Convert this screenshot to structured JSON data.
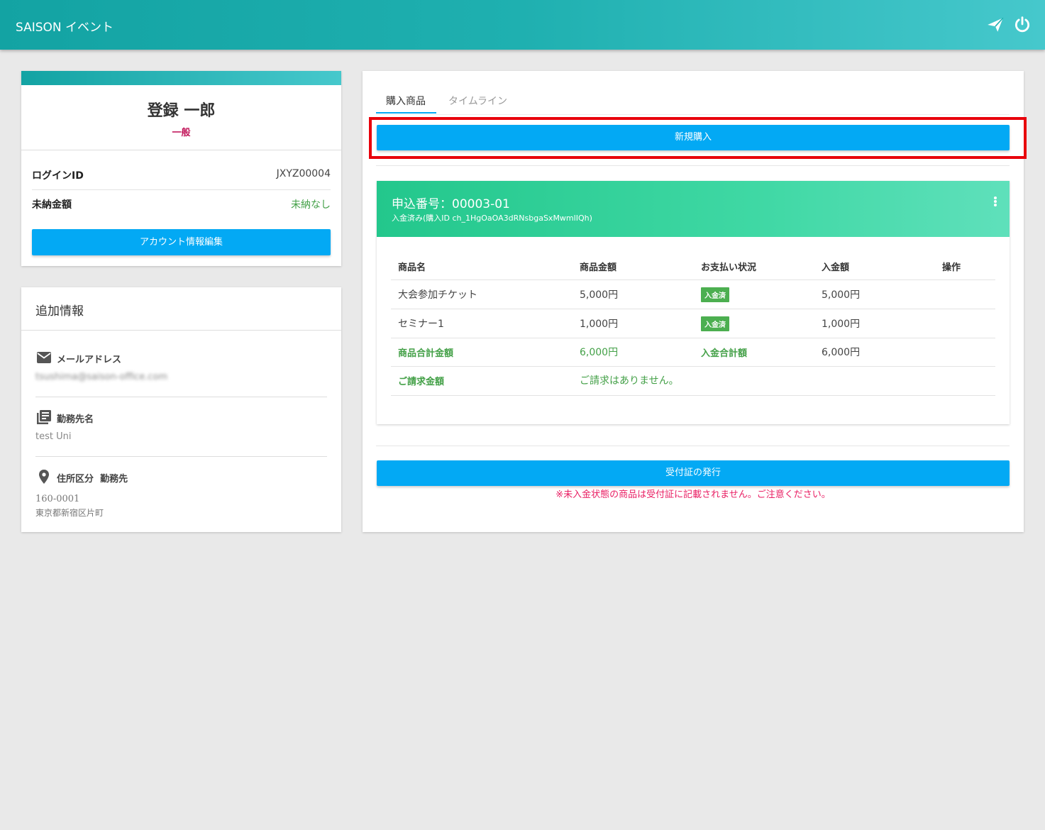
{
  "app": {
    "title": "SAISON イベント"
  },
  "topbar": {
    "icons": [
      "send-icon",
      "power-icon"
    ]
  },
  "profile": {
    "name": "登録 一郎",
    "role": "一般",
    "login_id_label": "ログインID",
    "login_id_value": "JXYZ00004",
    "unpaid_label": "未納金額",
    "unpaid_value": "未納なし",
    "edit_button": "アカウント情報編集"
  },
  "extra": {
    "title": "追加情報",
    "email_label": "メールアドレス",
    "email_value": "tsushima@saison-office.com",
    "company_label": "勤務先名",
    "company_value": "test Uni",
    "address_label": "住所区分",
    "address_type": "勤務先",
    "postal": "160-0001",
    "address": "東京都新宿区片町"
  },
  "tabs": [
    {
      "label": "購入商品",
      "active": true
    },
    {
      "label": "タイムライン",
      "active": false
    }
  ],
  "new_purchase_button": "新規購入",
  "order": {
    "number": "申込番号：00003-01",
    "status": "入金済み(購入ID ch_1HgOaOA3dRNsbgaSxMwmlIQh)",
    "headers": [
      "商品名",
      "商品金額",
      "お支払い状況",
      "入金額",
      "操作"
    ],
    "rows": [
      {
        "name": "大会参加チケット",
        "price": "5,000円",
        "status": "入金済",
        "paid": "5,000円"
      },
      {
        "name": "セミナー1",
        "price": "1,000円",
        "status": "入金済",
        "paid": "1,000円"
      }
    ],
    "total_label": "商品合計金額",
    "total_value": "6,000円",
    "paid_total_label": "入金合計額",
    "paid_total_value": "6,000円",
    "billing_label": "ご請求金額",
    "billing_value": "ご請求はありません。"
  },
  "receipt_button": "受付証の発行",
  "warning": "※未入金状態の商品は受付証に記載されません。ご注意ください。",
  "colors": {
    "accent": "#03a9f4",
    "header_teal": "#13a3a3",
    "order_green": "#23c78c",
    "highlight": "#e8000b"
  }
}
